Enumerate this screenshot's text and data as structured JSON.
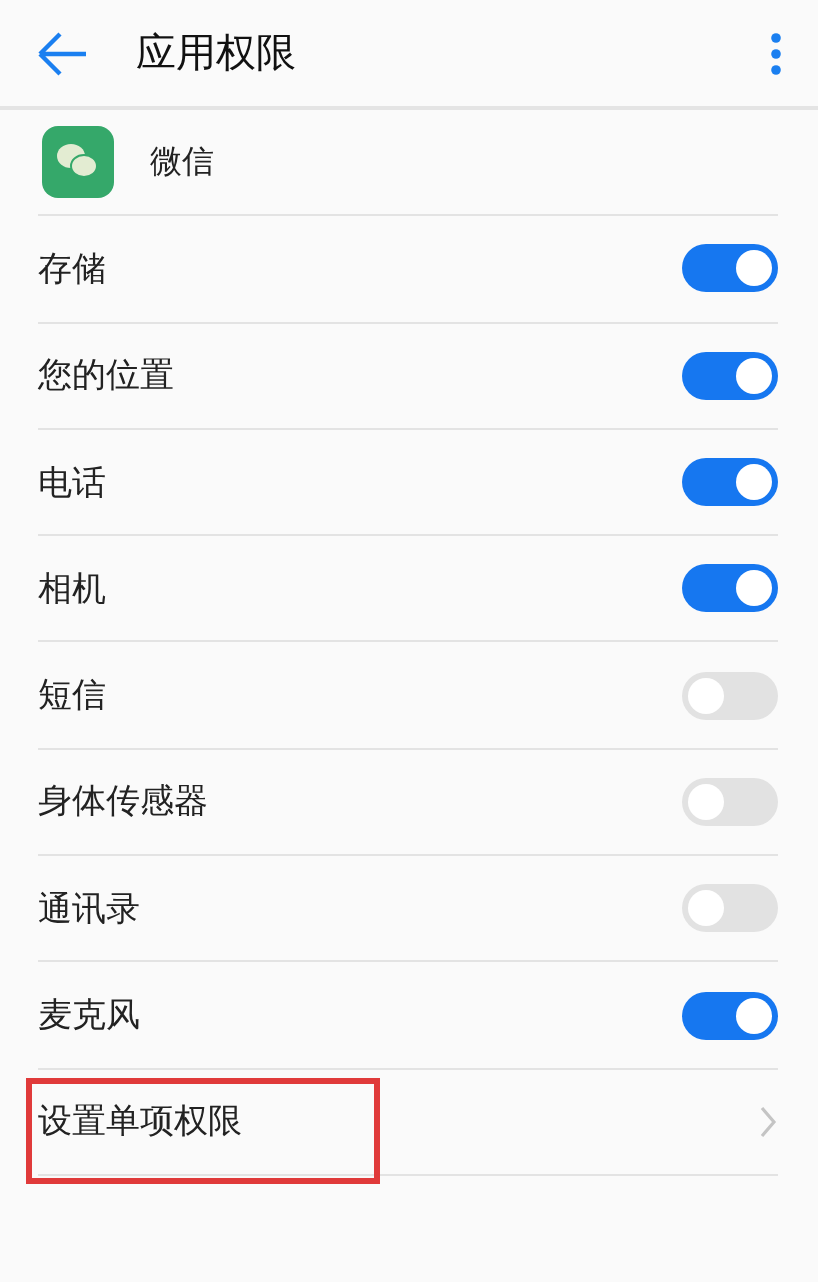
{
  "header": {
    "title": "应用权限"
  },
  "app": {
    "name": "微信"
  },
  "permissions": [
    {
      "label": "存储",
      "on": true
    },
    {
      "label": "您的位置",
      "on": true
    },
    {
      "label": "电话",
      "on": true
    },
    {
      "label": "相机",
      "on": true
    },
    {
      "label": "短信",
      "on": false
    },
    {
      "label": "身体传感器",
      "on": false
    },
    {
      "label": "通讯录",
      "on": false
    },
    {
      "label": "麦克风",
      "on": true
    }
  ],
  "link": {
    "label": "设置单项权限",
    "highlighted": true
  }
}
